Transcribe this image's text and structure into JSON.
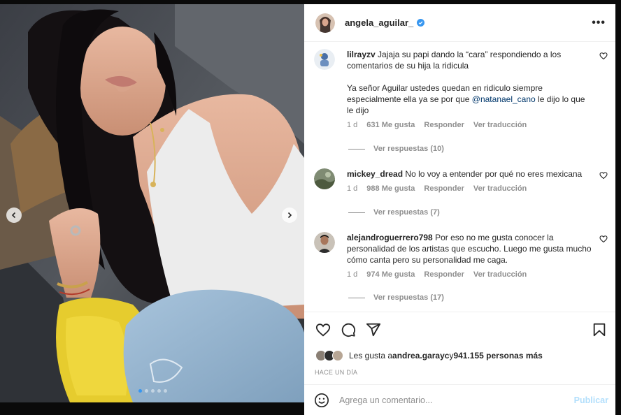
{
  "post": {
    "username": "angela_aguilar_",
    "more_label": "•••"
  },
  "carousel": {
    "slide_count": 5,
    "active_index": 0
  },
  "comments": [
    {
      "username": "lilrayzv",
      "text": "Jajaja su papi dando la “cara” respondiendo a los comentarios de su hija la ridicula",
      "text2_pre": "Ya señor Aguilar ustedes quedan en ridiculo siempre especialmente ella ya se por que ",
      "mention": "@natanael_cano",
      "text2_post": " le dijo lo que le dijo",
      "time": "1 d",
      "likes": "631 Me gusta",
      "reply": "Responder",
      "translate": "Ver traducción",
      "view_replies": "Ver respuestas (10)"
    },
    {
      "username": "mickey_dread",
      "text": "No lo voy a entender por qué no eres mexicana",
      "time": "1 d",
      "likes": "988 Me gusta",
      "reply": "Responder",
      "translate": "Ver traducción",
      "view_replies": "Ver respuestas (7)"
    },
    {
      "username": "alejandroguerrero798",
      "text": "Por eso no me gusta conocer la personalidad de los artistas que escucho. Luego me gusta mucho cómo canta pero su personalidad me caga.",
      "time": "1 d",
      "likes": "974 Me gusta",
      "reply": "Responder",
      "translate": "Ver traducción",
      "view_replies": "Ver respuestas (17)"
    }
  ],
  "likes_summary": {
    "prefix": "Les gusta a ",
    "user": "andrea.garayc",
    "middle": " y ",
    "count": "941.155 personas más"
  },
  "timestamp": "HACE UN DÍA",
  "add_comment": {
    "placeholder": "Agrega un comentario...",
    "publish_label": "Publicar"
  },
  "colors": {
    "verified": "#3897f0",
    "mention": "#00376b",
    "publish_disabled": "#b2dffc"
  },
  "icons": [
    "chevron-left-icon",
    "chevron-right-icon",
    "verified-icon",
    "more-icon",
    "heart-icon",
    "comment-icon",
    "share-icon",
    "bookmark-icon",
    "emoji-icon"
  ]
}
